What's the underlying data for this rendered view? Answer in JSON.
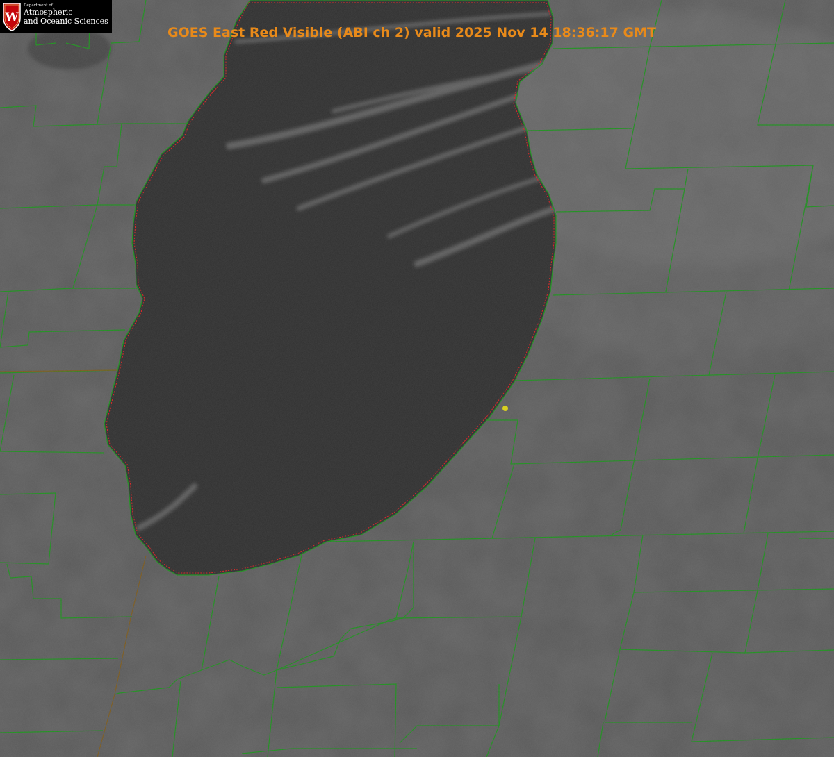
{
  "logo": {
    "department": "Department of",
    "name_line1": "Atmospheric",
    "name_line2": "and Oceanic Sciences",
    "crest_letter": "W",
    "crest_color": "#c5050c"
  },
  "title": "GOES East Red Visible (ABI ch 2) valid 2025 Nov 14 18:36:17 GMT",
  "colors": {
    "land": "#555555",
    "lake": "#303030",
    "county_lines": "#1f8f1f",
    "coastline": "#e02020",
    "title_text": "#e88a1a",
    "station_marker": "#d8d020"
  },
  "map_features": [
    "lake",
    "county-boundaries",
    "state-border",
    "lake-shoreline",
    "cloud-streaks",
    "station-marker"
  ]
}
